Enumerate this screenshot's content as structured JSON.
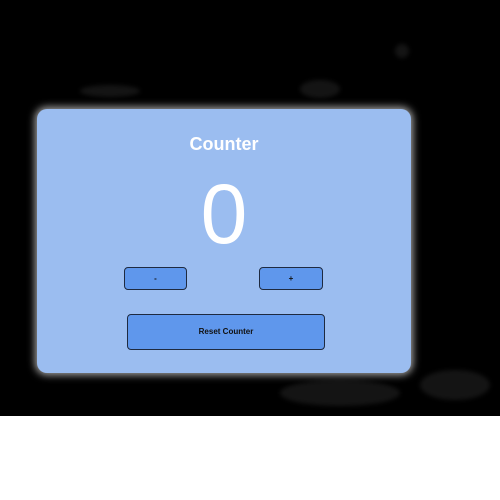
{
  "counter": {
    "title": "Counter",
    "value": "0",
    "decrement_label": "-",
    "increment_label": "+",
    "reset_label": "Reset Counter"
  },
  "colors": {
    "backdrop": "#000000",
    "card": "#9bbdf0",
    "button": "#5f97ec",
    "text": "#ffffff"
  }
}
